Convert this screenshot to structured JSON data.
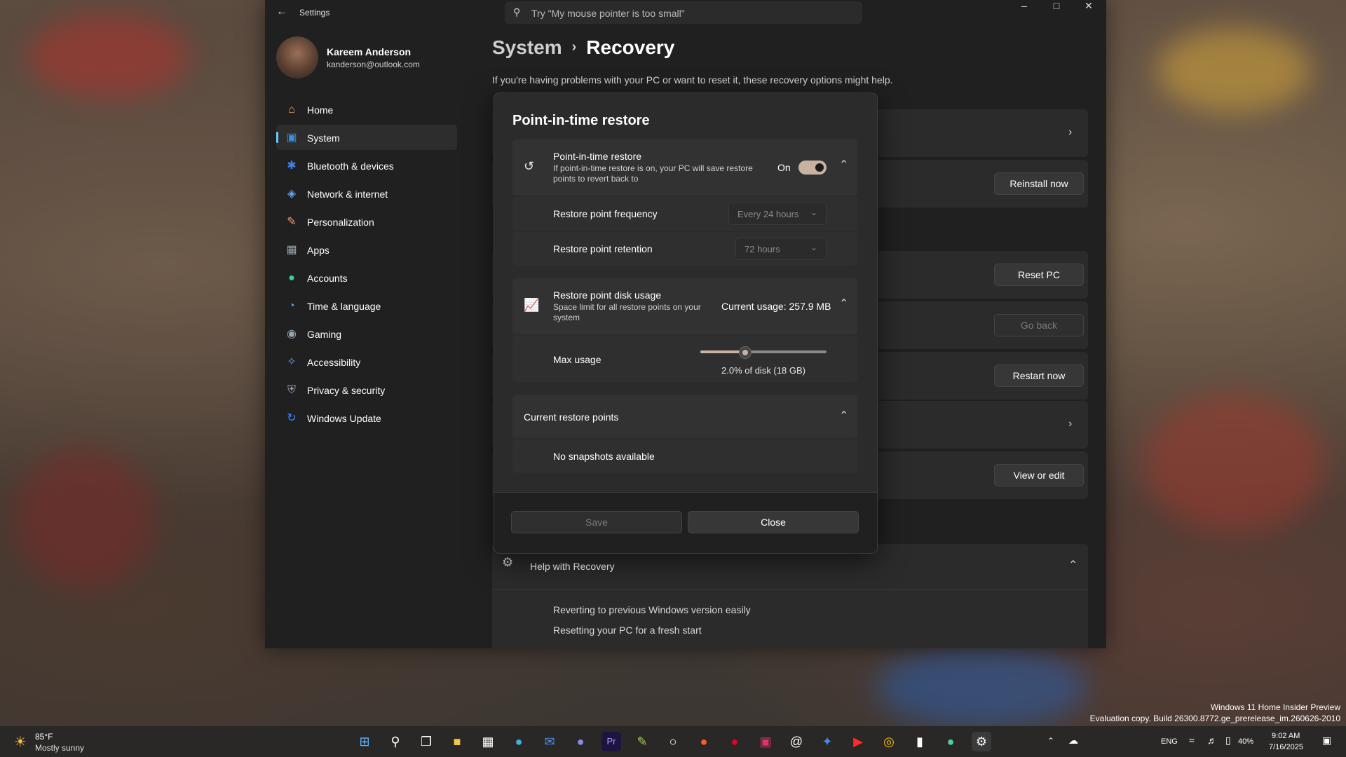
{
  "window": {
    "app_title": "Settings",
    "search_placeholder": "Try \"My mouse pointer is too small\""
  },
  "profile": {
    "name": "Kareem Anderson",
    "email": "kanderson@outlook.com"
  },
  "sidebar": {
    "items": [
      {
        "label": "Home",
        "icon": "home-icon",
        "color": "#f2a66f"
      },
      {
        "label": "System",
        "icon": "monitor-icon",
        "color": "#3a8de0"
      },
      {
        "label": "Bluetooth & devices",
        "icon": "bluetooth-icon",
        "color": "#3b82f6"
      },
      {
        "label": "Network & internet",
        "icon": "wifi-icon",
        "color": "#60a5fa"
      },
      {
        "label": "Personalization",
        "icon": "brush-icon",
        "color": "#f59e6a"
      },
      {
        "label": "Apps",
        "icon": "apps-icon",
        "color": "#9aa4b2"
      },
      {
        "label": "Accounts",
        "icon": "person-icon",
        "color": "#34d399"
      },
      {
        "label": "Time & language",
        "icon": "globe-clock-icon",
        "color": "#60a5fa"
      },
      {
        "label": "Gaming",
        "icon": "gamepad-icon",
        "color": "#9aa4b2"
      },
      {
        "label": "Accessibility",
        "icon": "accessibility-icon",
        "color": "#60a5fa"
      },
      {
        "label": "Privacy & security",
        "icon": "shield-icon",
        "color": "#9aa4b2"
      },
      {
        "label": "Windows Update",
        "icon": "update-icon",
        "color": "#3b82f6"
      }
    ],
    "active_index": 1
  },
  "main": {
    "breadcrumb_parent": "System",
    "breadcrumb_current": "Recovery",
    "description": "If you're having problems with your PC or want to reset it, these recovery options might help.",
    "buttons": {
      "reinstall": "Reinstall now",
      "reset": "Reset PC",
      "go_back": "Go back",
      "restart": "Restart now",
      "view_edit": "View or edit"
    },
    "help": {
      "title": "Help with Recovery",
      "links": [
        "Reverting to previous Windows version easily",
        "Resetting your PC for a fresh start"
      ]
    }
  },
  "dialog": {
    "title": "Point-in-time restore",
    "pitr": {
      "title": "Point-in-time restore",
      "subtitle": "If point-in-time restore is on, your PC will save restore points to revert back to",
      "state_label": "On",
      "enabled": true
    },
    "frequency": {
      "label": "Restore point frequency",
      "value": "Every 24 hours"
    },
    "retention": {
      "label": "Restore point retention",
      "value": "72 hours"
    },
    "disk": {
      "title": "Restore point disk usage",
      "subtitle": "Space limit for all restore points on your system",
      "current": "Current usage: 257.9 MB"
    },
    "max_usage": {
      "label": "Max usage",
      "value_text": "2.0% of disk (18 GB)",
      "slider_fraction": 0.35
    },
    "restore_points": {
      "title": "Current restore points",
      "empty_text": "No snapshots available"
    },
    "save_label": "Save",
    "close_label": "Close"
  },
  "taskbar": {
    "weather_temp": "85°F",
    "weather_desc": "Mostly sunny",
    "lang": "ENG",
    "battery": "40%",
    "time": "9:02 AM",
    "date": "7/16/2025"
  },
  "watermark": {
    "line1": "Windows 11 Home Insider Preview",
    "line2": "Evaluation copy. Build 26300.8772.ge_prerelease_im.260626-2010"
  }
}
